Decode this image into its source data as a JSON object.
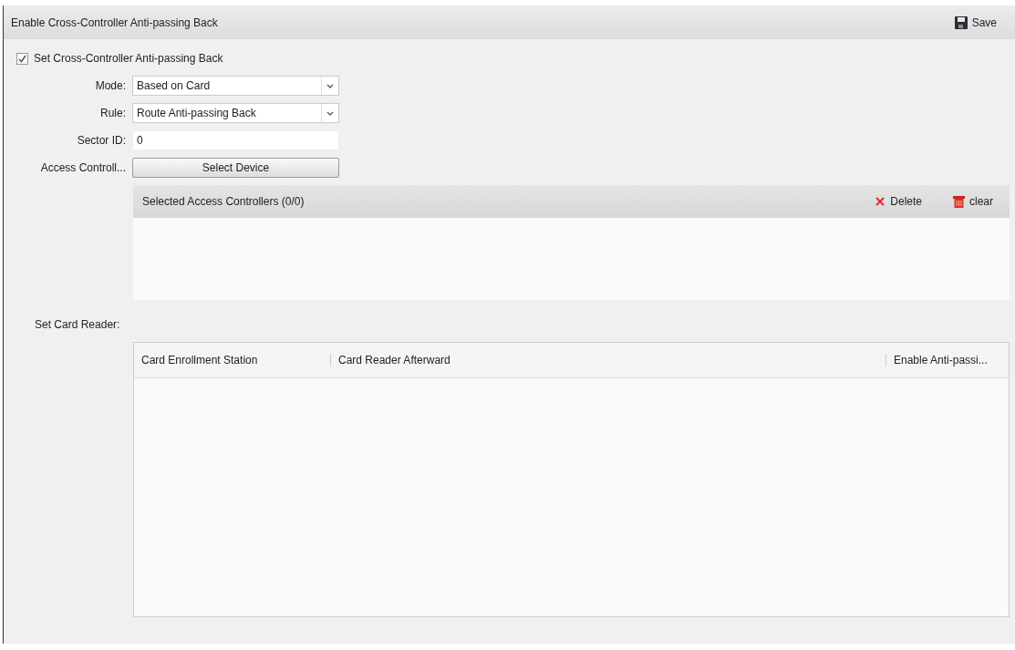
{
  "header": {
    "title": "Enable Cross-Controller Anti-passing Back",
    "save_label": "Save"
  },
  "form": {
    "enable_checkbox": {
      "label": "Set Cross-Controller Anti-passing Back",
      "checked": true
    },
    "mode": {
      "label": "Mode:",
      "value": "Based on Card"
    },
    "rule": {
      "label": "Rule:",
      "value": "Route Anti-passing Back"
    },
    "sector_id": {
      "label": "Sector ID:",
      "value": "0"
    },
    "access_controller": {
      "label": "Access Controll...",
      "button": "Select Device"
    }
  },
  "selected_controllers": {
    "title": "Selected Access Controllers (0/0)",
    "actions": [
      {
        "kind": "delete",
        "label": "Delete"
      },
      {
        "kind": "clear",
        "label": "clear"
      }
    ]
  },
  "card_reader": {
    "label": "Set Card Reader:",
    "columns": [
      "Card Enrollment Station",
      "Card Reader Afterward",
      "Enable Anti-passi..."
    ]
  }
}
